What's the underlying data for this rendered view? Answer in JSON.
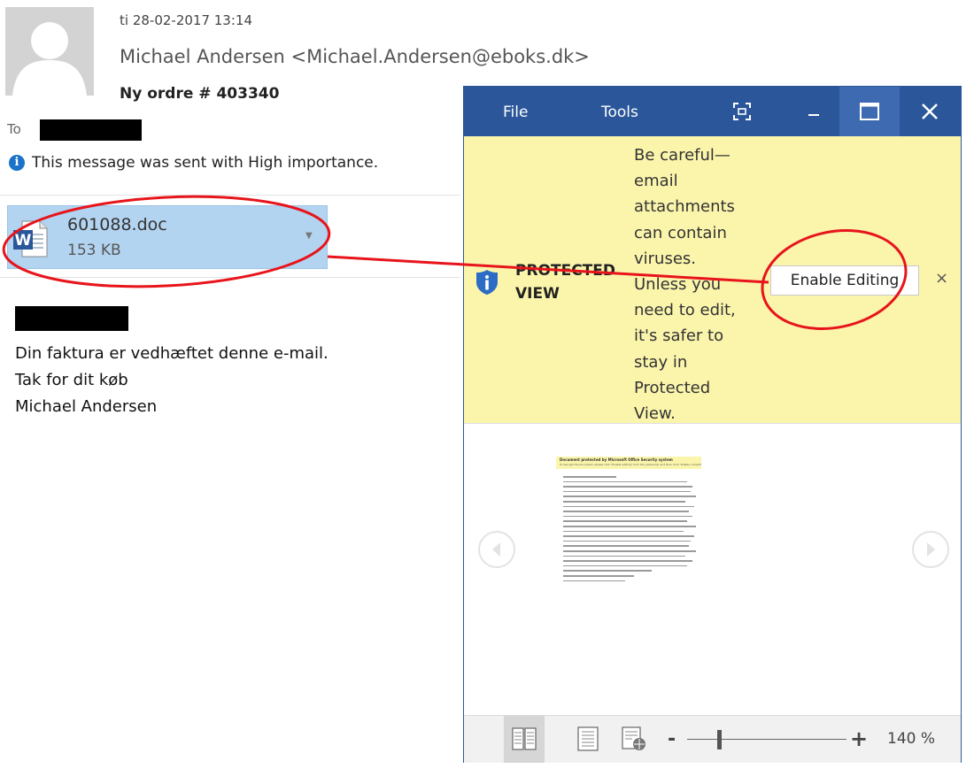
{
  "email": {
    "date": "ti 28-02-2017 13:14",
    "sender": "Michael Andersen <Michael.Andersen@eboks.dk>",
    "subject": "Ny ordre # 403340",
    "to_label": "To",
    "importance": "This message was sent with High importance.",
    "attachment": {
      "name": "601088.doc",
      "size": "153 KB",
      "icon": "word-doc-icon"
    },
    "body_lines": [
      "Din faktura er vedhæftet denne e-mail.",
      "Tak for dit køb",
      "Michael Andersen"
    ]
  },
  "word": {
    "menu": {
      "file": "File",
      "tools": "Tools"
    },
    "protected_view": {
      "label_line1": "PROTECTED",
      "label_line2": "VIEW",
      "message_lines": [
        "Be careful—",
        "email",
        "attachments",
        "can contain",
        "viruses.",
        "Unless you",
        "need to edit,",
        "it's safer to",
        "stay in",
        "Protected",
        "View."
      ],
      "enable_button": "Enable Editing",
      "close": "×"
    },
    "thumbnail": {
      "title": "Document protected by Microsoft Office Security system",
      "subtitle": "To decrypt the document, please click \"Enable editing\" from the yellow bar and then click \"Enable content\""
    },
    "statusbar": {
      "zoom_minus": "-",
      "zoom_plus": "+",
      "zoom_level": "140 %",
      "zoom_fraction": 0.2
    }
  },
  "colors": {
    "word_blue": "#2b579a",
    "warning_yellow": "#fbf5ac",
    "attachment_blue": "#b3d4f0",
    "annotation_red": "#e8141b"
  }
}
